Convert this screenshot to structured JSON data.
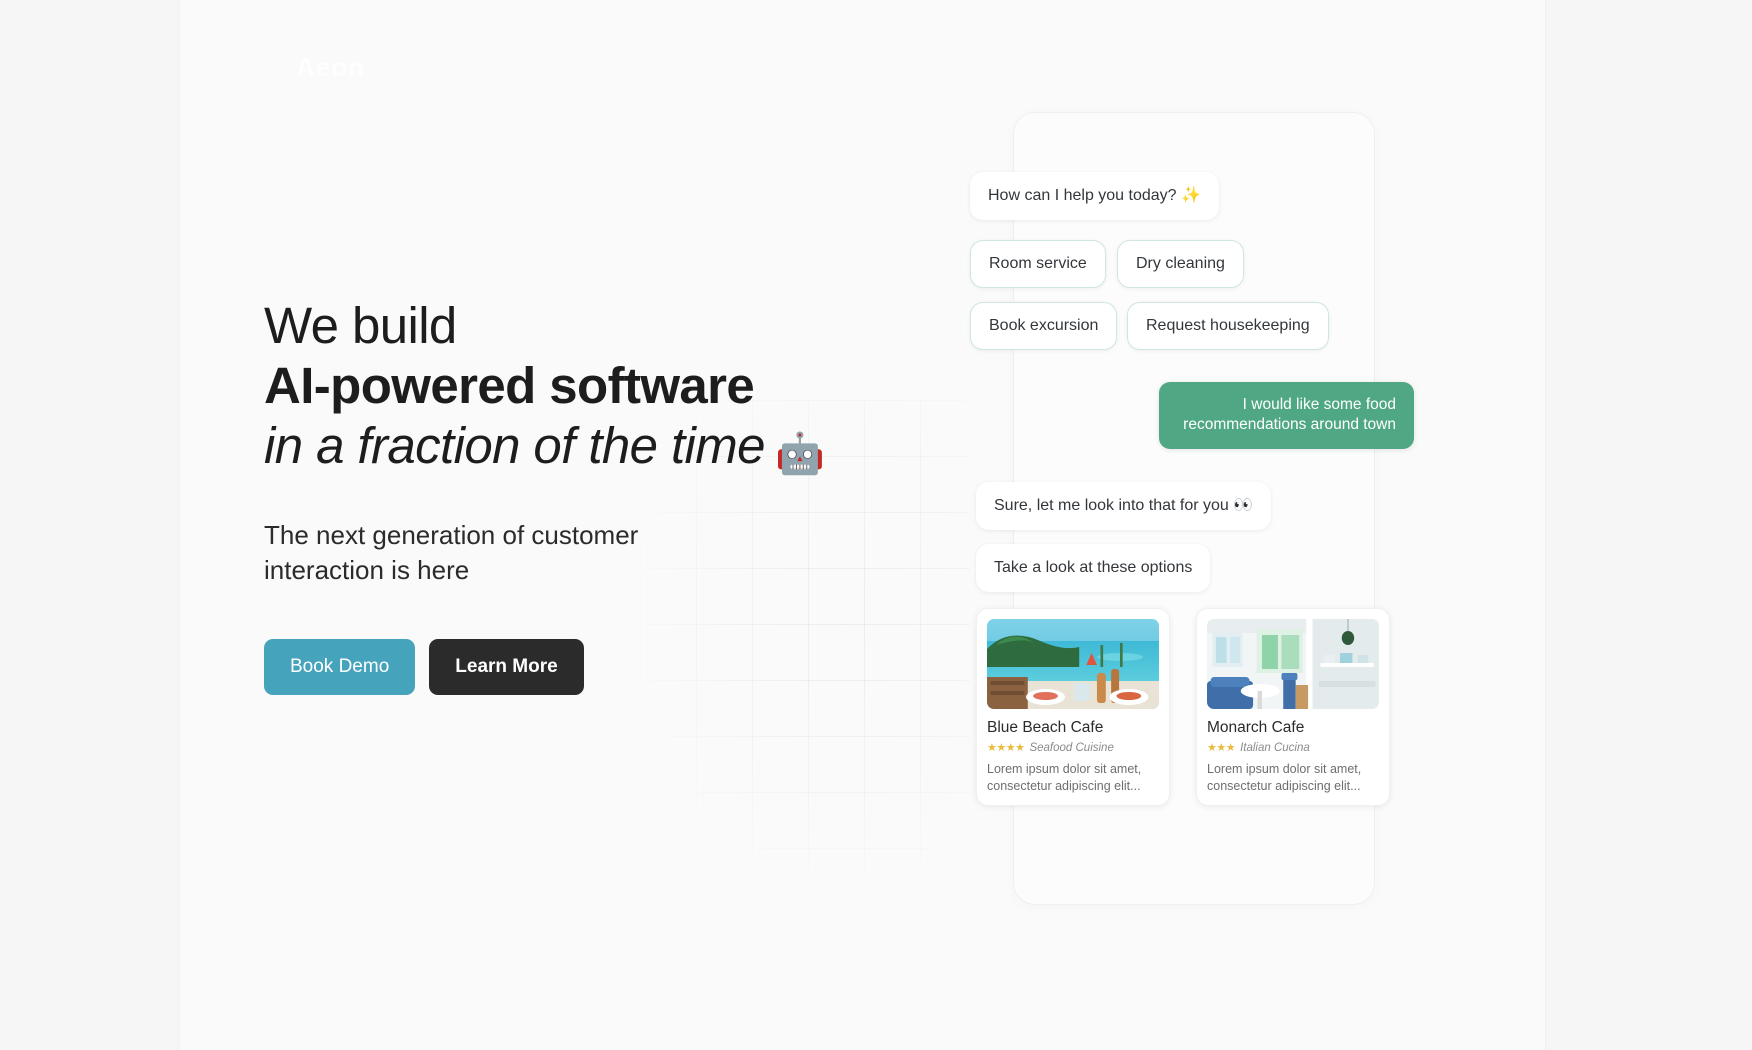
{
  "brand": {
    "logo_text": "Aeon"
  },
  "hero": {
    "headline_line1": "We build",
    "headline_line2": "AI-powered software",
    "headline_line3": "in a fraction of the time",
    "headline_emoji": "🤖",
    "subhead": "The next generation of customer interaction is here",
    "cta_primary": "Book Demo",
    "cta_secondary": "Learn More"
  },
  "chat": {
    "greeting": "How can I help you today? ✨",
    "quick_replies": [
      "Room service",
      "Dry cleaning",
      "Book excursion",
      "Request housekeeping"
    ],
    "user_message": "I would like some food recommendations around town",
    "bot_reply_1": "Sure, let me look into that for you 👀",
    "bot_reply_2": "Take a look at these options",
    "cards": [
      {
        "title": "Blue Beach Cafe",
        "stars": "★★★★",
        "rating": 4,
        "cuisine": "Seafood Cuisine",
        "description": "Lorem ipsum dolor sit amet, consectetur adipiscing elit..."
      },
      {
        "title": "Monarch Cafe",
        "stars": "★★★",
        "rating": 3,
        "cuisine": "Italian Cucina",
        "description": "Lorem ipsum dolor sit amet, consectetur adipiscing elit..."
      }
    ]
  },
  "colors": {
    "accent_teal": "#46a3bc",
    "accent_dark": "#2b2b2b",
    "bubble_green": "#4fa883",
    "chip_border": "#cfe8da",
    "star_gold": "#e8bb3a"
  }
}
